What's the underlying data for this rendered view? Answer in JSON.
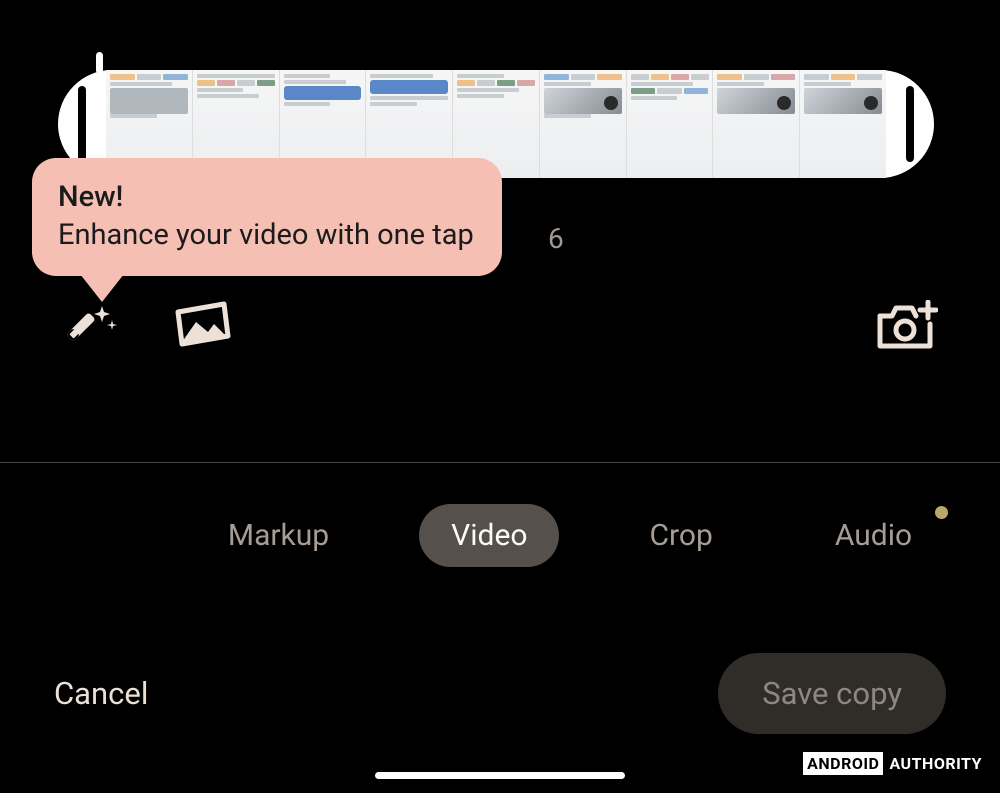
{
  "tooltip": {
    "title": "New!",
    "body": "Enhance your video with one tap"
  },
  "timestamp_partial": "6",
  "tools": {
    "enhance": "magic-wand-icon",
    "frame": "frame-photo-icon",
    "export_frame": "camera-plus-icon"
  },
  "tabs": {
    "items": [
      {
        "label": "Markup",
        "active": false,
        "dot": false
      },
      {
        "label": "Video",
        "active": true,
        "dot": false
      },
      {
        "label": "Crop",
        "active": false,
        "dot": false
      },
      {
        "label": "Audio",
        "active": false,
        "dot": true
      }
    ]
  },
  "actions": {
    "cancel": "Cancel",
    "save": "Save copy"
  },
  "watermark": {
    "brand_boxed": "ANDROID",
    "brand_rest": "AUTHORITY"
  },
  "colors": {
    "tooltip_bg": "#f5bfb4",
    "tab_active_bg": "#55504b",
    "icon_color": "#ede1d7",
    "dot_color": "#baa869"
  }
}
